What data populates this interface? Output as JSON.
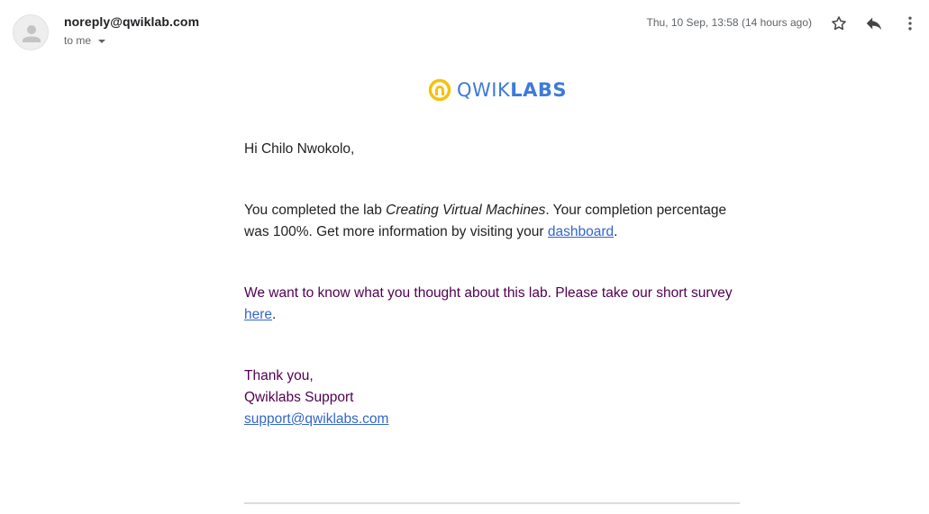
{
  "email": {
    "sender": "noreply@qwiklab.com",
    "recipient_label": "to me",
    "date": "Thu, 10 Sep, 13:58 (14 hours ago)"
  },
  "toolbar": {
    "star_icon": "star-icon",
    "reply_icon": "reply-icon",
    "more_icon": "more-vertical-icon"
  },
  "logo": {
    "word_part1": "QWIK",
    "word_part2": "LABS",
    "accent_color": "#f4c20d",
    "brand_color": "#3e7ad9"
  },
  "body": {
    "greeting": "Hi Chilo Nwokolo,",
    "completed_prefix": "You completed the lab ",
    "lab_name": "Creating Virtual Machines",
    "completed_middle": ". Your completion percentage was 100%. Get more information by visiting your ",
    "dashboard_link": "dashboard",
    "completed_end": ".",
    "survey_prefix": "We want to know what you thought about this lab. Please take our short survey ",
    "survey_link": "here",
    "survey_end": ".",
    "thanks": "Thank you,",
    "signature": "Qwiklabs Support",
    "support_email": "support@qwiklabs.com"
  },
  "colors": {
    "link": "#3366cc",
    "quoted_text": "#500050"
  }
}
